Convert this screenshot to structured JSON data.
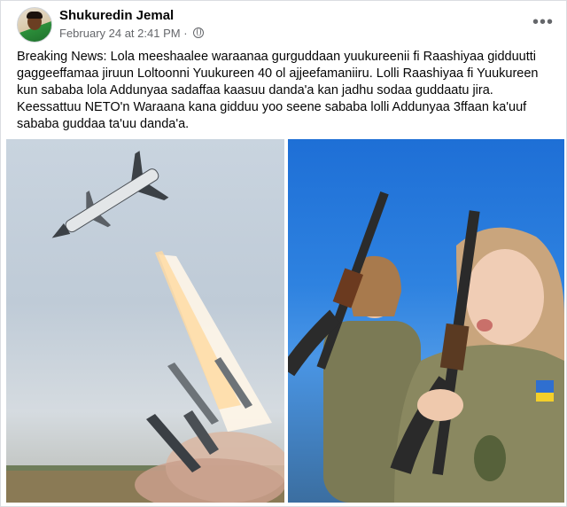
{
  "post": {
    "author": "Shukuredin Jemal",
    "timestamp": "February 24 at 2:41 PM",
    "separator": "·",
    "privacy_icon": "globe-icon",
    "more_icon": "more-horizontal-icon",
    "more_label": "•••",
    "body": "Breaking News: Lola meeshaalee waraanaa gurguddaan yuukureenii fi Raashiyaa gidduutti gaggeeffamaa jiruun Loltoonni Yuukureen 40 ol ajjeefamaniiru. Lolli Raashiyaa fi Yuukureen kun sababa lola Addunyaa sadaffaa kaasuu danda'a kan jadhu sodaa guddaatu jira. Keessattuu NETO'n Waraana kana gidduu yoo seene sababa lolli Addunyaa 3ffaan ka'uuf sababa guddaa ta'uu danda'a."
  },
  "media": {
    "left_image": "missile-launch-photo",
    "right_image": "soldiers-with-rifles-photo"
  },
  "colors": {
    "text_primary": "#050505",
    "text_secondary": "#65676b",
    "sky_blue": "#2e82e0"
  }
}
